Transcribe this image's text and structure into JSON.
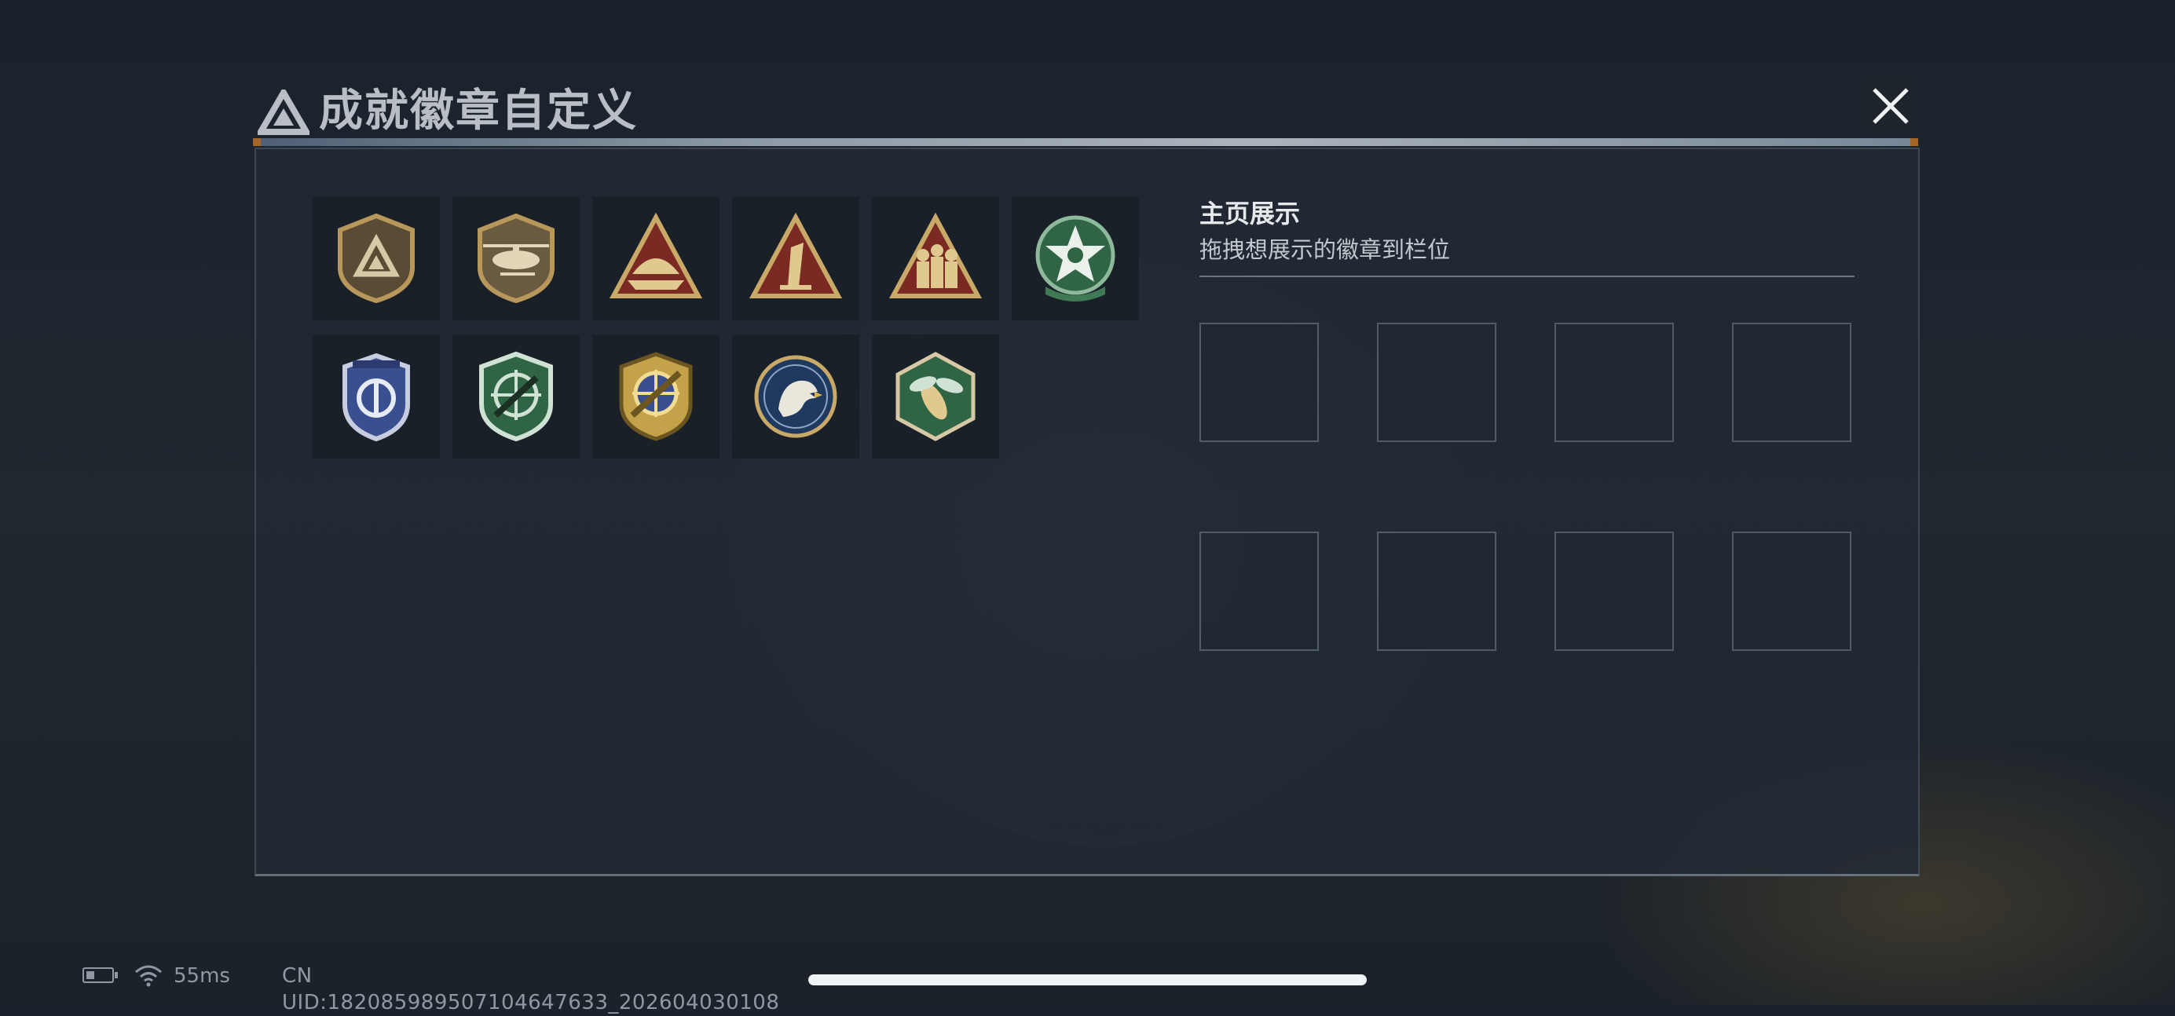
{
  "dialog": {
    "title": "成就徽章自定义"
  },
  "badges": [
    {
      "name": "logo-shield-badge"
    },
    {
      "name": "helicopter-badge"
    },
    {
      "name": "boat-badge"
    },
    {
      "name": "number-one-badge"
    },
    {
      "name": "soldiers-badge"
    },
    {
      "name": "green-star-badge"
    },
    {
      "name": "blue-shield-badge"
    },
    {
      "name": "green-crosshair-rifle-badge"
    },
    {
      "name": "gold-crosshair-badge"
    },
    {
      "name": "eagle-badge"
    },
    {
      "name": "wasp-badge"
    }
  ],
  "showcase": {
    "title": "主页展示",
    "hint": "拖拽想展示的徽章到栏位",
    "slot_count": 8
  },
  "status": {
    "ping": "55ms",
    "uid": "CN UID:182085989507104647633_202604030108"
  },
  "colors": {
    "gold": "#b7975a",
    "dark_red": "#7a2a22",
    "green": "#3f7a55",
    "blue": "#3a4f8f",
    "accent_orange": "#c87826"
  }
}
